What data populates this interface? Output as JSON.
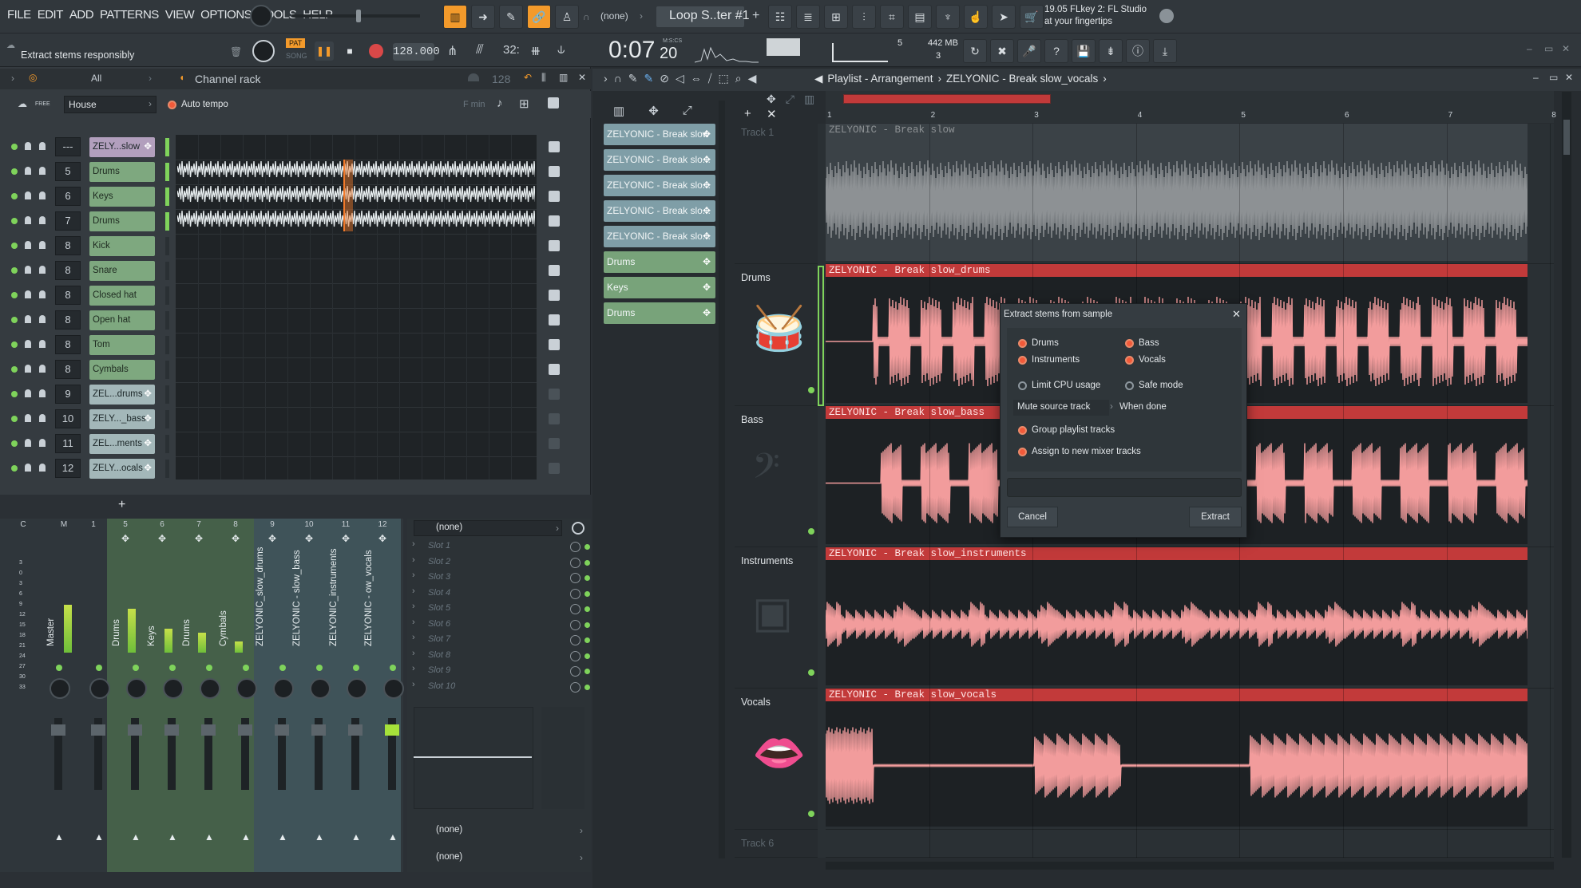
{
  "menu": [
    "FILE",
    "EDIT",
    "ADD",
    "PATTERNS",
    "VIEW",
    "OPTIONS",
    "TOOLS",
    "HELP"
  ],
  "pattern_none": "(none)",
  "pattern_name": "Loop S..ter #1",
  "news": {
    "line1": "19.05  FLkey 2: FL Studio",
    "line2": "at your fingertips"
  },
  "hint_text": "Extract stems responsibly",
  "transport": {
    "mode_pat": "PAT",
    "mode_song": "SONG",
    "tempo": "128.000",
    "time": "0:07",
    "time_small": "20",
    "time_unit": "M:S:CS"
  },
  "cpu": {
    "value": "5",
    "memory": "442 MB",
    "voices": "3"
  },
  "channel_rack": {
    "filter": "All",
    "title": "Channel rack",
    "swing": "128",
    "genre_tag": "FREE",
    "genre": "House",
    "auto_tempo": "Auto tempo",
    "key_label": "F min",
    "channels": [
      {
        "num": "---",
        "name": "ZELY...slow",
        "plug": true,
        "first": true
      },
      {
        "num": "5",
        "name": "Drums",
        "plug": false
      },
      {
        "num": "6",
        "name": "Keys",
        "plug": false
      },
      {
        "num": "7",
        "name": "Drums",
        "plug": false
      },
      {
        "num": "8",
        "name": "Kick",
        "plug": false
      },
      {
        "num": "8",
        "name": "Snare",
        "plug": false
      },
      {
        "num": "8",
        "name": "Closed hat",
        "plug": false
      },
      {
        "num": "8",
        "name": "Open hat",
        "plug": false
      },
      {
        "num": "8",
        "name": "Tom",
        "plug": false
      },
      {
        "num": "8",
        "name": "Cymbals",
        "plug": false
      },
      {
        "num": "9",
        "name": "ZEL...drums",
        "plug": true
      },
      {
        "num": "10",
        "name": "ZELY..._bass",
        "plug": true
      },
      {
        "num": "11",
        "name": "ZEL...ments",
        "plug": true
      },
      {
        "num": "12",
        "name": "ZELY...ocals",
        "plug": true
      }
    ],
    "add_label": "+"
  },
  "mixer": {
    "header": [
      "C",
      "M",
      "1",
      "5",
      "6",
      "7",
      "8",
      "9",
      "10",
      "11",
      "12"
    ],
    "meter_scale": [
      "3",
      "0",
      "3",
      "6",
      "9",
      "12",
      "15",
      "18",
      "21",
      "24",
      "27",
      "30",
      "33"
    ],
    "strips": [
      "Master",
      "",
      "Drums",
      "Keys",
      "Drums",
      "Cymbals",
      "ZELYONIC_slow_drums",
      "ZELYONIC - slow_bass",
      "ZELYONIC_instruments",
      "ZELYONIC - ow_vocals"
    ]
  },
  "fx_slots": {
    "preset": "(none)",
    "slots": [
      "Slot 1",
      "Slot 2",
      "Slot 3",
      "Slot 4",
      "Slot 5",
      "Slot 6",
      "Slot 7",
      "Slot 8",
      "Slot 9",
      "Slot 10"
    ],
    "eq_none": "(none)",
    "out_none": "(none)"
  },
  "playlist": {
    "breadcrumb": [
      "Playlist - Arrangement",
      "ZELYONIC - Break slow_vocals"
    ],
    "clips": [
      {
        "name": "ZELYONIC - Break slow",
        "kind": "audio"
      },
      {
        "name": "ZELYONIC - Break slo...",
        "kind": "audio"
      },
      {
        "name": "ZELYONIC - Break slo...",
        "kind": "audio"
      },
      {
        "name": "ZELYONIC - Break slo...",
        "kind": "audio"
      },
      {
        "name": "ZELYONIC - Break slo...",
        "kind": "audio"
      },
      {
        "name": "Drums",
        "kind": "pattern"
      },
      {
        "name": "Keys",
        "kind": "pattern"
      },
      {
        "name": "Drums",
        "kind": "pattern"
      }
    ],
    "ruler": [
      "1",
      "2",
      "3",
      "4",
      "5",
      "6",
      "7",
      "8"
    ],
    "tracks": [
      {
        "label": "Track 1",
        "clip": "ZELYONIC - Break slow"
      },
      {
        "label": "Drums",
        "clip": "ZELYONIC - Break slow_drums"
      },
      {
        "label": "Bass",
        "clip": "ZELYONIC - Break slow_bass"
      },
      {
        "label": "Instruments",
        "clip": "ZELYONIC - Break slow_instruments"
      },
      {
        "label": "Vocals",
        "clip": "ZELYONIC - Break slow_vocals"
      },
      {
        "label": "Track 6",
        "clip": ""
      }
    ]
  },
  "dialog": {
    "title": "Extract stems from sample",
    "drums": "Drums",
    "bass": "Bass",
    "instruments": "Instruments",
    "vocals": "Vocals",
    "limit_cpu": "Limit CPU usage",
    "safe_mode": "Safe mode",
    "mute_source": "Mute source track",
    "when_done": "When done",
    "group_tracks": "Group playlist tracks",
    "assign_mixer": "Assign to new mixer tracks",
    "cancel": "Cancel",
    "extract": "Extract"
  },
  "colors": {
    "accent": "#f39a2b",
    "clip_red": "#c23a3a",
    "wave_pink": "#f29c9c",
    "wave_grey": "#8d9194",
    "channel_green": "#7ea87f"
  }
}
